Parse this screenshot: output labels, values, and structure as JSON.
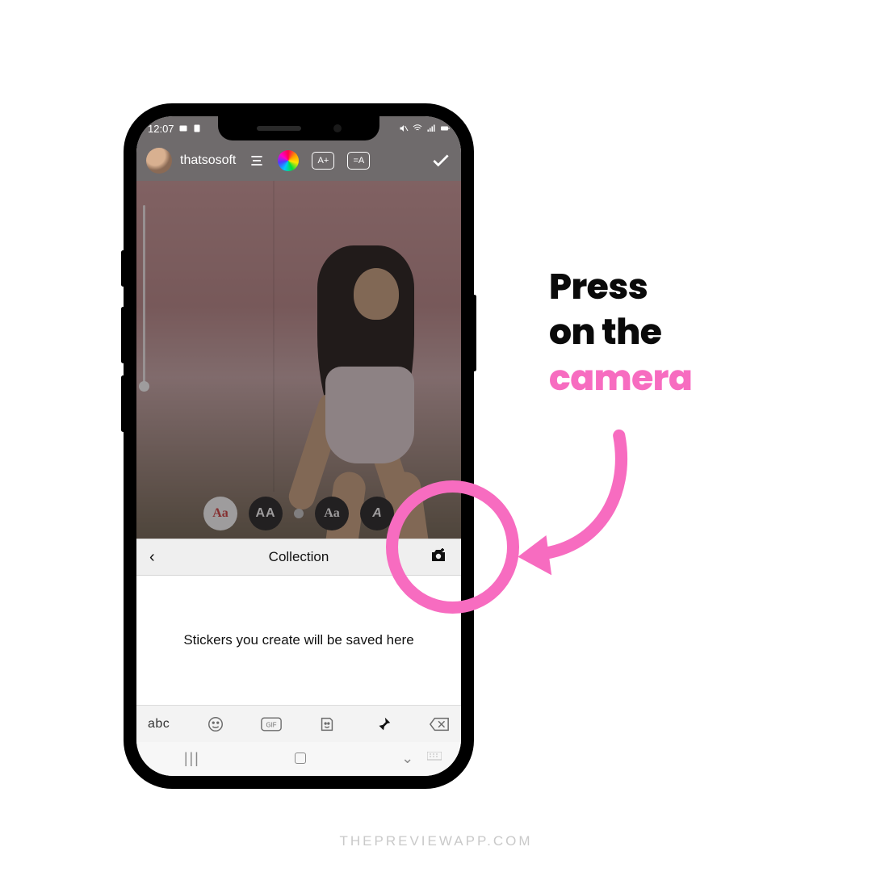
{
  "statusbar": {
    "time": "12:07"
  },
  "story_editor": {
    "username": "thatsosoft",
    "text_size_label": "A+",
    "text_bg_label": "=A",
    "font_options": [
      "Aa",
      "AA",
      "Aa",
      "A"
    ]
  },
  "collection": {
    "back_glyph": "‹",
    "title": "Collection",
    "empty_message": "Stickers you create will be saved here"
  },
  "keyboard": {
    "abc_label": "abc",
    "gif_label": "GIF",
    "nav_recent": "|||",
    "nav_down": "⌄"
  },
  "instruction": {
    "line1": "Press",
    "line2": "on the",
    "line3": "camera"
  },
  "watermark": "THEPREVIEWAPP.COM",
  "colors": {
    "accent_pink": "#f76cc0"
  }
}
